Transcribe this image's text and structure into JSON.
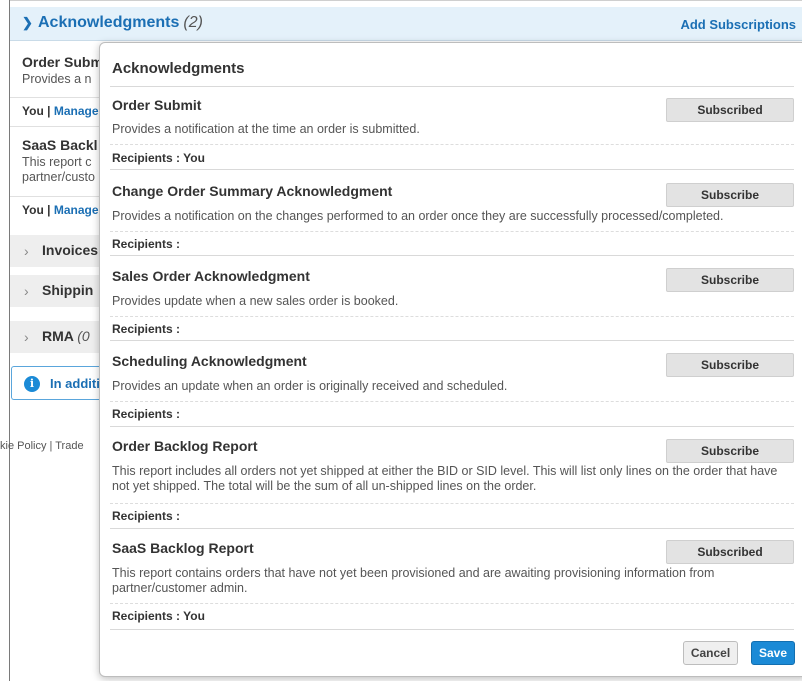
{
  "section": {
    "title": "Acknowledgments",
    "count": "(2)",
    "add_link": "Add Subscriptions"
  },
  "background": {
    "items": [
      {
        "title": "Order Subm",
        "desc": "Provides a n",
        "you": "You",
        "sep": "|",
        "manage": "Manage"
      },
      {
        "title": "SaaS Backl",
        "desc1": "This report c",
        "desc2": "partner/custo",
        "you": "You",
        "sep": "|",
        "manage": "Manage"
      }
    ],
    "accordions": [
      {
        "label": "Invoices",
        "count": ""
      },
      {
        "label": "Shippin",
        "count": ""
      },
      {
        "label": "RMA",
        "count": "(0"
      }
    ],
    "info_text": "In additi",
    "info_icon": "info-circle-icon",
    "footer": {
      "cookie": "kie Policy",
      "sep": "|",
      "trade": "Trade"
    }
  },
  "panel": {
    "title": "Acknowledgments",
    "recipients_label": "Recipients :",
    "items": [
      {
        "title": "Order Submit",
        "desc": "Provides a notification at the time an order is submitted.",
        "button": "Subscribed",
        "recipients": "Recipients : You"
      },
      {
        "title": "Change Order Summary Acknowledgment",
        "desc": "Provides a notification on the changes performed to an order once they are successfully processed/completed.",
        "button": "Subscribe",
        "recipients": "Recipients :"
      },
      {
        "title": "Sales Order Acknowledgment",
        "desc": "Provides update when a new sales order is booked.",
        "button": "Subscribe",
        "recipients": "Recipients :"
      },
      {
        "title": "Scheduling Acknowledgment",
        "desc": "Provides an update when an order is originally received and scheduled.",
        "button": "Subscribe",
        "recipients": "Recipients :"
      },
      {
        "title": "Order Backlog Report",
        "desc": "This report includes all orders not yet shipped at either the BID or SID level. This will list only lines on the order that have not yet shipped. The total will be the sum of all un-shipped lines on the order.",
        "button": "Subscribe",
        "recipients": "Recipients :"
      },
      {
        "title": "SaaS Backlog Report",
        "desc": "This report contains orders that have not yet been provisioned and are awaiting provisioning information from partner/customer admin.",
        "button": "Subscribed",
        "recipients": "Recipients : You"
      }
    ],
    "cancel_label": "Cancel",
    "save_label": "Save"
  },
  "colors": {
    "accent": "#1b6fb4",
    "save_button": "#1b8ad6",
    "header_bg": "#e4f1fa",
    "subscribe_button": "#e3e3e3"
  }
}
